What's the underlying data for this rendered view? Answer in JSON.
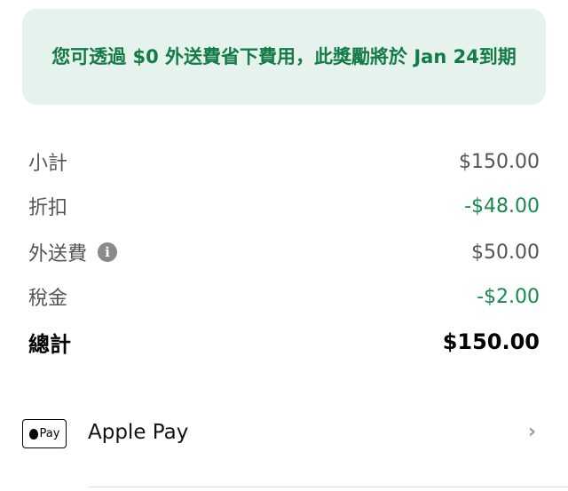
{
  "promo": {
    "message": "您可透過 $0 外送費省下費用，此獎勵將於 Jan 24到期"
  },
  "summary": {
    "subtotal": {
      "label": "小計",
      "value": "$150.00"
    },
    "discount": {
      "label": "折扣",
      "value": "-$48.00"
    },
    "delivery_fee": {
      "label": "外送費",
      "value": "$50.00",
      "icon": "info-icon"
    },
    "tax": {
      "label": "稅金",
      "value": "-$2.00"
    },
    "total": {
      "label": "總計",
      "value": "$150.00"
    }
  },
  "payment": {
    "badge_text": "Pay",
    "method": "Apple Pay",
    "chevron": "›"
  },
  "colors": {
    "promo_bg": "#e6f2ec",
    "promo_text": "#137b48",
    "discount_green": "#148a4c"
  }
}
